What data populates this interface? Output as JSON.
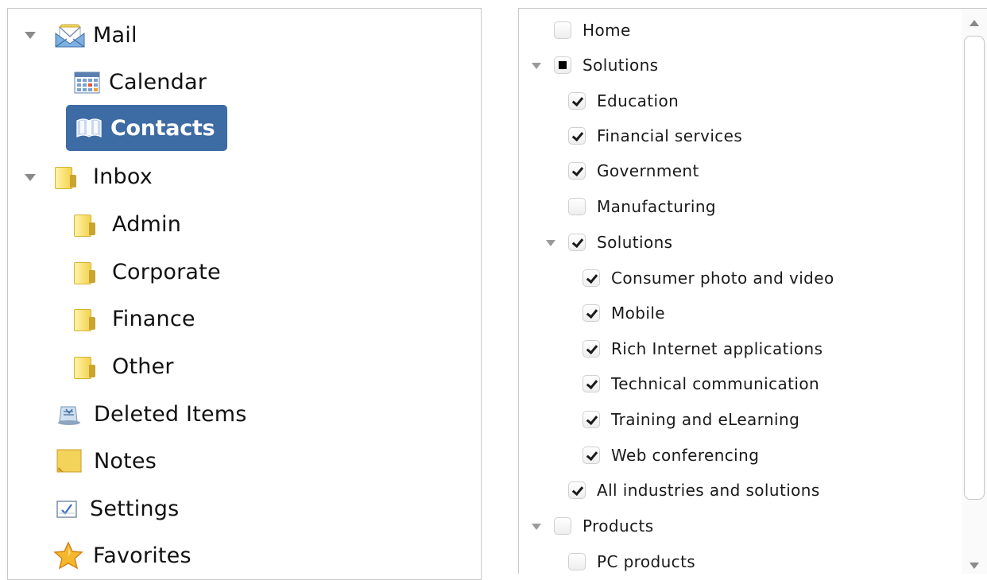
{
  "left_tree": {
    "items": [
      {
        "label": "Mail",
        "icon": "mail-envelope-icon"
      },
      {
        "label": "Calendar",
        "icon": "calendar-icon"
      },
      {
        "label": "Contacts",
        "icon": "contacts-book-icon",
        "selected": true
      },
      {
        "label": "Inbox",
        "icon": "folder-icon"
      },
      {
        "label": "Admin",
        "icon": "folder-icon"
      },
      {
        "label": "Corporate",
        "icon": "folder-icon"
      },
      {
        "label": "Finance",
        "icon": "folder-icon"
      },
      {
        "label": "Other",
        "icon": "folder-icon"
      },
      {
        "label": "Deleted Items",
        "icon": "recycle-bin-icon"
      },
      {
        "label": "Notes",
        "icon": "note-icon"
      },
      {
        "label": "Settings",
        "icon": "settings-checkbox-icon"
      },
      {
        "label": "Favorites",
        "icon": "star-icon"
      }
    ],
    "selected_color": "#3d6ba4"
  },
  "right_tree": {
    "items": [
      {
        "label": "Home",
        "state": "unchecked"
      },
      {
        "label": "Solutions",
        "state": "partial"
      },
      {
        "label": "Education",
        "state": "checked"
      },
      {
        "label": "Financial services",
        "state": "checked"
      },
      {
        "label": "Government",
        "state": "checked"
      },
      {
        "label": "Manufacturing",
        "state": "unchecked"
      },
      {
        "label": "Solutions",
        "state": "checked"
      },
      {
        "label": "Consumer photo and video",
        "state": "checked"
      },
      {
        "label": "Mobile",
        "state": "checked"
      },
      {
        "label": "Rich Internet applications",
        "state": "checked"
      },
      {
        "label": "Technical communication",
        "state": "checked"
      },
      {
        "label": "Training and eLearning",
        "state": "checked"
      },
      {
        "label": "Web conferencing",
        "state": "checked"
      },
      {
        "label": "All industries and solutions",
        "state": "checked"
      },
      {
        "label": "Products",
        "state": "unchecked"
      },
      {
        "label": "PC products",
        "state": "unchecked"
      }
    ]
  }
}
